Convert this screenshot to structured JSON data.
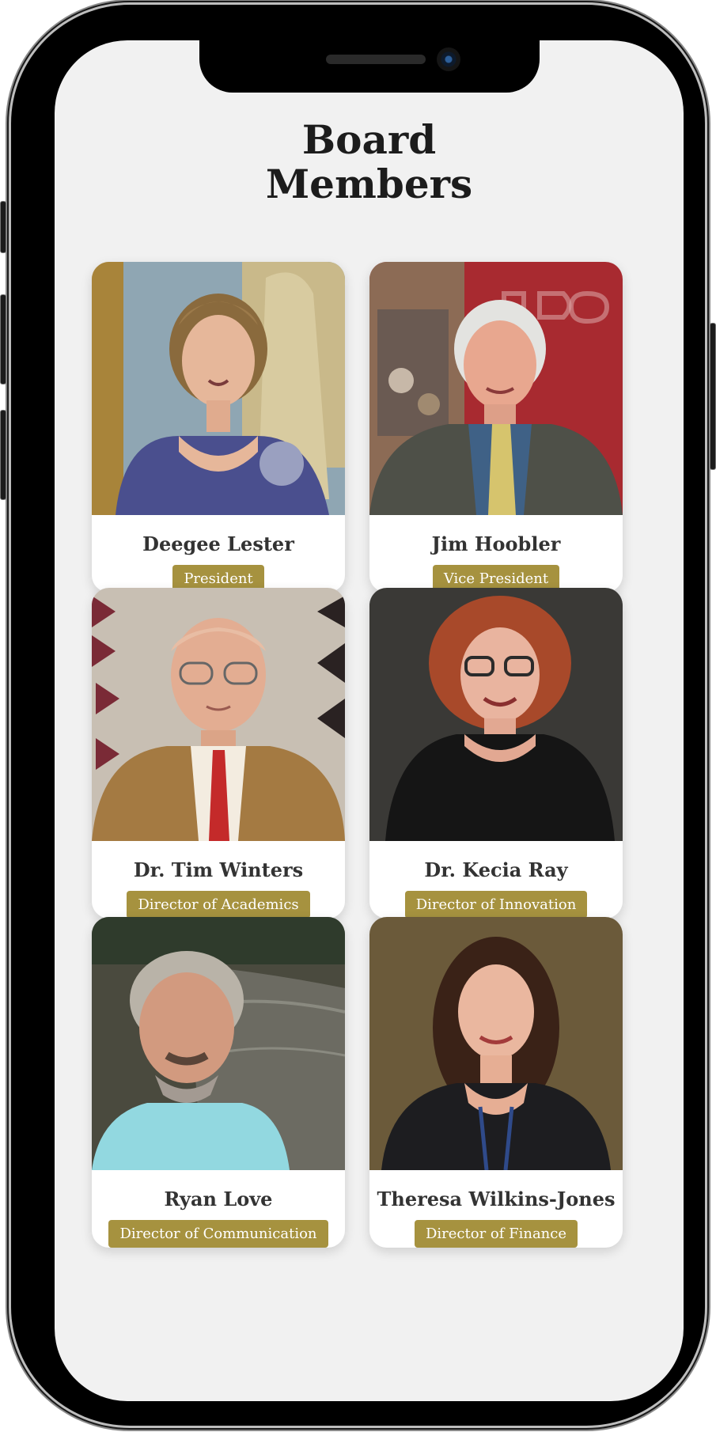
{
  "page": {
    "title_line1": "Board",
    "title_line2": "Members"
  },
  "colors": {
    "background": "#f1f1f1",
    "badge": "#a6923f",
    "name_text": "#333333",
    "title_text": "#1c1c1c"
  },
  "members": [
    {
      "name": "Deegee Lester",
      "role": "President"
    },
    {
      "name": "Jim Hoobler",
      "role": "Vice President"
    },
    {
      "name": "Dr. Tim Winters",
      "role": "Director of Academics"
    },
    {
      "name": "Dr. Kecia Ray",
      "role": "Director of Innovation"
    },
    {
      "name": "Ryan Love",
      "role": "Director of Communication"
    },
    {
      "name": "Theresa Wilkins-Jones",
      "role": "Director of Finance"
    }
  ]
}
